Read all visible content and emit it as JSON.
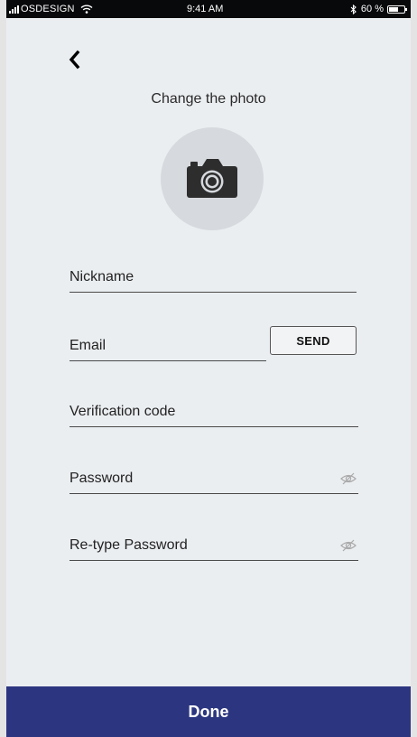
{
  "status_bar": {
    "carrier": "OSDESIGN",
    "time": "9:41 AM",
    "battery": "60 %",
    "battery_level": 0.6
  },
  "header": {
    "back_icon": "chevron-left-icon",
    "photo_title": "Change the photo",
    "photo_icon": "camera-icon"
  },
  "form": {
    "nickname_label": "Nickname",
    "email_label": "Email",
    "send_label": "SEND",
    "verification_label": "Verification code",
    "password_label": "Password",
    "retype_label": "Re-type Password",
    "visibility_icon": "eye-slash-icon"
  },
  "footer": {
    "done_label": "Done"
  },
  "colors": {
    "background": "#ebeef1",
    "accent": "#2c3680",
    "avatar_bg": "#d6d9dd"
  }
}
